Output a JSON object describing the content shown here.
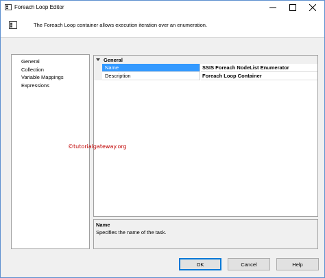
{
  "window": {
    "title": "Foreach Loop Editor"
  },
  "header": {
    "description": "The Foreach Loop container allows execution iteration over an enumeration."
  },
  "nav": {
    "items": [
      {
        "label": "General"
      },
      {
        "label": "Collection"
      },
      {
        "label": "Variable Mappings"
      },
      {
        "label": "Expressions"
      }
    ]
  },
  "grid": {
    "category": "General",
    "rows": [
      {
        "name": "Name",
        "value": "SSIS Foreach NodeList Enumerator"
      },
      {
        "name": "Description",
        "value": "Foreach Loop Container"
      }
    ]
  },
  "watermark": "©tutorialgateway.org",
  "help": {
    "title": "Name",
    "text": "Specifies the name of the task."
  },
  "buttons": {
    "ok": "OK",
    "cancel": "Cancel",
    "help": "Help"
  },
  "colors": {
    "selection": "#3399ff",
    "watermark": "#c00000",
    "accent": "#0078d7"
  },
  "icons": {
    "app": "foreach-loop-icon",
    "header": "foreach-loop-icon",
    "minimize": "minimize-icon",
    "maximize": "maximize-icon",
    "close": "close-icon",
    "category": "collapse-caret-icon"
  }
}
